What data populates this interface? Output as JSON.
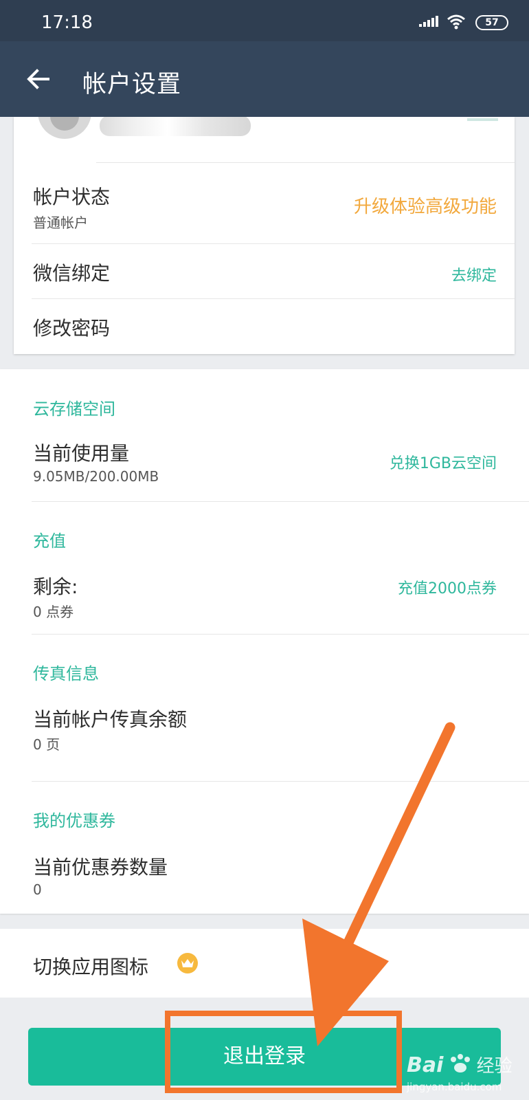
{
  "status_bar": {
    "time": "17:18",
    "battery": "57",
    "signal_icon": "signal-icon",
    "wifi_icon": "wifi-icon"
  },
  "app_bar": {
    "back_icon": "arrow-left-icon",
    "title": "帐户设置"
  },
  "account_card": {
    "status": {
      "title": "帐户状态",
      "value": "普通帐户",
      "action": "升级体验高级功能"
    },
    "wechat": {
      "title": "微信绑定",
      "action": "去绑定"
    },
    "password": {
      "title": "修改密码"
    }
  },
  "sections": {
    "storage": {
      "label": "云存储空间",
      "title": "当前使用量",
      "value": "9.05MB/200.00MB",
      "action": "兑换1GB云空间"
    },
    "recharge": {
      "label": "充值",
      "title": "剩余:",
      "value": "0 点券",
      "action": "充值2000点券"
    },
    "fax": {
      "label": "传真信息",
      "title": "当前帐户传真余额",
      "value": "0 页"
    },
    "coupons": {
      "label": "我的优惠券",
      "title": "当前优惠券数量",
      "value": "0"
    }
  },
  "switch_icon": {
    "title": "切换应用图标",
    "badge_icon": "crown-icon"
  },
  "logout": {
    "label": "退出登录"
  },
  "watermark": {
    "brand": "Bai",
    "brand2": "经验",
    "site": "jingyan.baidu.com"
  },
  "colors": {
    "accent": "#2eb79c",
    "upgrade": "#f2a83c",
    "button": "#19bc9a",
    "annotation": "#f2752d",
    "app_bar": "#34465c"
  }
}
